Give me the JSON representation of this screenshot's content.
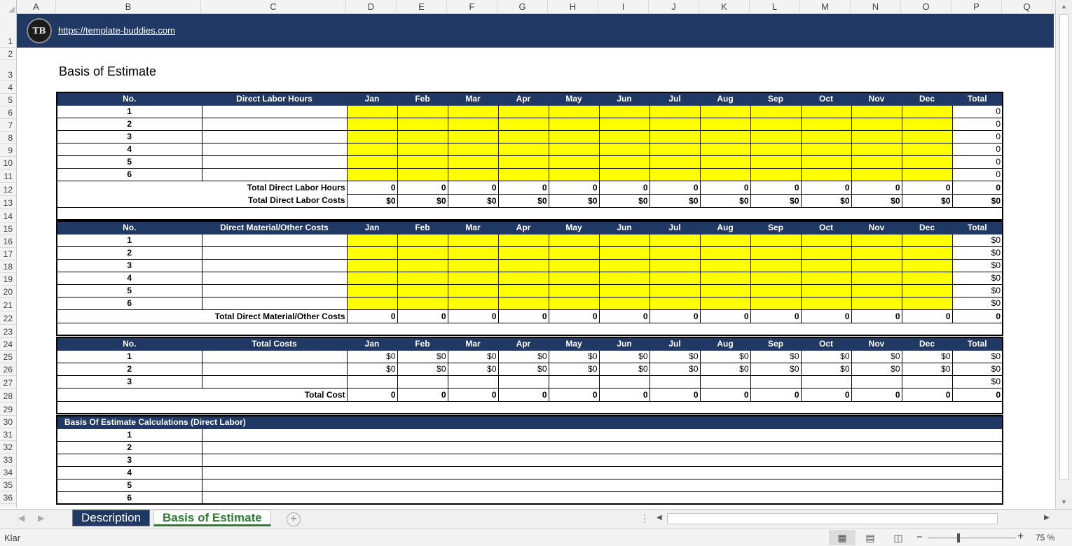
{
  "columns": [
    "A",
    "B",
    "C",
    "D",
    "E",
    "F",
    "G",
    "H",
    "I",
    "J",
    "K",
    "L",
    "M",
    "N",
    "O",
    "P",
    "Q"
  ],
  "rows": [
    "1",
    "2",
    "3",
    "4",
    "5",
    "6",
    "7",
    "8",
    "9",
    "10",
    "11",
    "12",
    "13",
    "14",
    "15",
    "16",
    "17",
    "18",
    "19",
    "20",
    "21",
    "22",
    "23",
    "24",
    "25",
    "26",
    "27",
    "28",
    "29",
    "30",
    "31",
    "32",
    "33",
    "34",
    "35",
    "36"
  ],
  "banner": {
    "logo_text": "TB",
    "link": "https://template-buddies.com"
  },
  "title": "Basis of Estimate",
  "months": [
    "Jan",
    "Feb",
    "Mar",
    "Apr",
    "May",
    "Jun",
    "Jul",
    "Aug",
    "Sep",
    "Oct",
    "Nov",
    "Dec"
  ],
  "labor": {
    "no_header": "No.",
    "header": "Direct Labor Hours",
    "total_header": "Total",
    "rows": [
      "1",
      "2",
      "3",
      "4",
      "5",
      "6"
    ],
    "row_total": "0",
    "total_hours_label": "Total Direct Labor Hours",
    "total_hours_values": [
      "0",
      "0",
      "0",
      "0",
      "0",
      "0",
      "0",
      "0",
      "0",
      "0",
      "0",
      "0",
      "0"
    ],
    "total_costs_label": "Total Direct Labor Costs",
    "total_costs_values": [
      "$0",
      "$0",
      "$0",
      "$0",
      "$0",
      "$0",
      "$0",
      "$0",
      "$0",
      "$0",
      "$0",
      "$0",
      "$0"
    ]
  },
  "material": {
    "no_header": "No.",
    "header": "Direct Material/Other Costs",
    "total_header": "Total",
    "rows": [
      "1",
      "2",
      "3",
      "4",
      "5",
      "6"
    ],
    "row_total": "$0",
    "total_label": "Total Direct Material/Other Costs",
    "total_values": [
      "0",
      "0",
      "0",
      "0",
      "0",
      "0",
      "0",
      "0",
      "0",
      "0",
      "0",
      "0",
      "0"
    ]
  },
  "costs": {
    "no_header": "No.",
    "header": "Total Costs",
    "total_header": "Total",
    "rows": [
      {
        "no": "1",
        "values": [
          "$0",
          "$0",
          "$0",
          "$0",
          "$0",
          "$0",
          "$0",
          "$0",
          "$0",
          "$0",
          "$0",
          "$0",
          "$0"
        ]
      },
      {
        "no": "2",
        "values": [
          "$0",
          "$0",
          "$0",
          "$0",
          "$0",
          "$0",
          "$0",
          "$0",
          "$0",
          "$0",
          "$0",
          "$0",
          "$0"
        ]
      },
      {
        "no": "3",
        "values": [
          "",
          "",
          "",
          "",
          "",
          "",
          "",
          "",
          "",
          "",
          "",
          "",
          "$0"
        ]
      }
    ],
    "total_label": "Total Cost",
    "total_values": [
      "0",
      "0",
      "0",
      "0",
      "0",
      "0",
      "0",
      "0",
      "0",
      "0",
      "0",
      "0",
      "0"
    ]
  },
  "calc": {
    "header": "Basis Of Estimate Calculations (Direct Labor)",
    "rows": [
      "1",
      "2",
      "3",
      "4",
      "5",
      "6"
    ]
  },
  "tabs": [
    {
      "label": "Description"
    },
    {
      "label": "Basis of Estimate"
    }
  ],
  "status": {
    "text": "Klar",
    "zoom": "75 %"
  }
}
